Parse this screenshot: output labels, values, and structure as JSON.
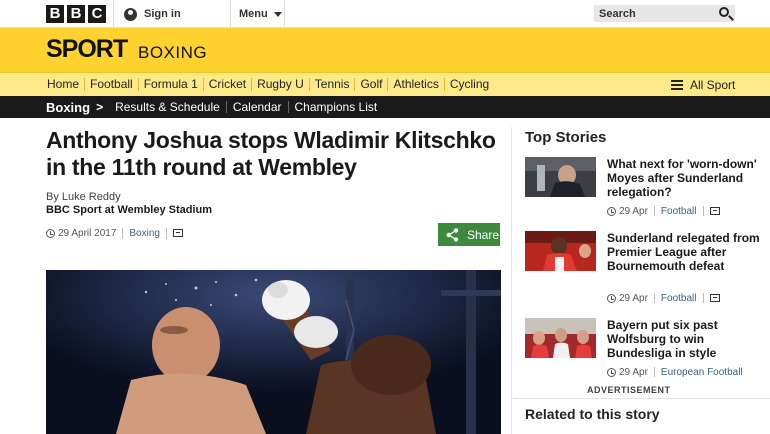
{
  "topbar": {
    "logo_letters": [
      "B",
      "B",
      "C"
    ],
    "signin_label": "Sign in",
    "menu_label": "Menu",
    "search_placeholder": "Search"
  },
  "header": {
    "brand": "SPORT",
    "section": "BOXING"
  },
  "nav": {
    "items": [
      "Home",
      "Football",
      "Formula 1",
      "Cricket",
      "Rugby U",
      "Tennis",
      "Golf",
      "Athletics",
      "Cycling"
    ],
    "all_sport_label": "All Sport"
  },
  "subnav": {
    "section": "Boxing",
    "arrow": ">",
    "links": [
      "Results & Schedule",
      "Calendar",
      "Champions List"
    ]
  },
  "article": {
    "headline": "Anthony Joshua stops Wladimir Klitschko in the 11th round at Wembley",
    "byline": "By Luke Reddy",
    "byline_org": "BBC Sport at Wembley Stadium",
    "date": "29 April 2017",
    "tag": "Boxing",
    "share_label": "Share"
  },
  "sidebar": {
    "title": "Top Stories",
    "stories": [
      {
        "title": "What next for 'worn-down' Moyes after Sunderland relegation?",
        "date": "29 Apr",
        "tag": "Football"
      },
      {
        "title": "Sunderland relegated from Premier League after Bournemouth defeat",
        "date": "29 Apr",
        "tag": "Football"
      },
      {
        "title": "Bayern put six past Wolfsburg to win Bundesliga in style",
        "date": "29 Apr",
        "tag": "European Football"
      }
    ],
    "advertisement": "ADVERTISEMENT",
    "related_title": "Related to this story"
  },
  "colors": {
    "sport_yellow": "#ffd230",
    "nav_yellow": "#fee98a",
    "subnav_black": "#1a1a1a",
    "share_green": "#3d8a3c",
    "tag_blue": "#37617d"
  }
}
